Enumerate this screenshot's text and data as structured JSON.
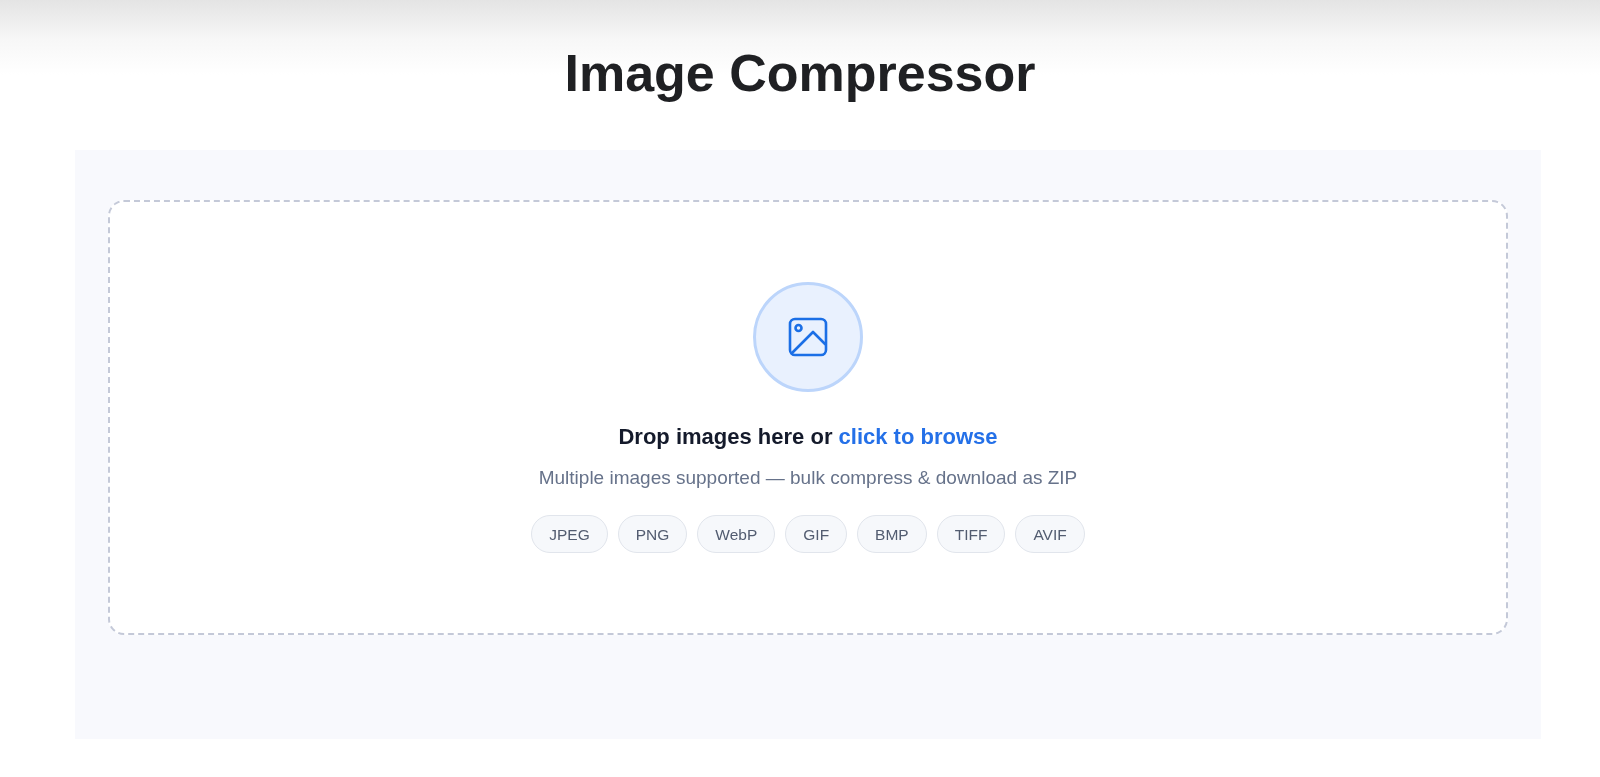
{
  "title": "Image Compressor",
  "dropzone": {
    "prompt": "Drop images here or",
    "link": "click to browse",
    "hint": "Multiple images supported — bulk compress & download as ZIP",
    "formats": [
      "JPEG",
      "PNG",
      "WebP",
      "GIF",
      "BMP",
      "TIFF",
      "AVIF"
    ]
  }
}
